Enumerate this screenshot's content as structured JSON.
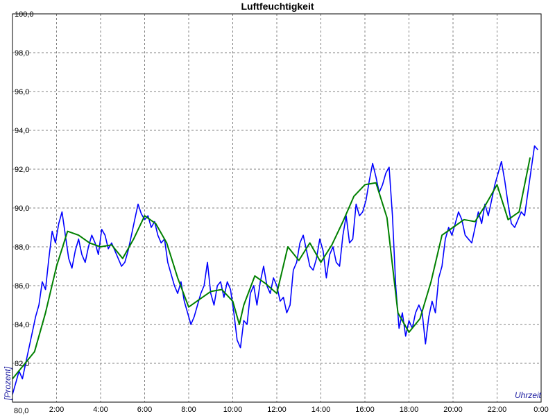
{
  "chart_data": {
    "type": "line",
    "title": "Luftfeuchtigkeit",
    "xlabel": "Uhrzeit",
    "ylabel": "[Prozent]",
    "xlim": [
      0,
      24
    ],
    "ylim": [
      80,
      100
    ],
    "grid": true,
    "x_tick_labels": [
      "2:00",
      "4:00",
      "6:00",
      "8:00",
      "10:00",
      "12:00",
      "14:00",
      "16:00",
      "18:00",
      "20:00",
      "22:00",
      "0:00"
    ],
    "y_tick_labels": [
      "82,0",
      "84,0",
      "86,0",
      "88,0",
      "90,0",
      "92,0",
      "94,0",
      "96,0",
      "98,0",
      "100,0"
    ],
    "corner_label": "80,0",
    "series": [
      {
        "color": "#0000ff",
        "x": [
          0.0,
          0.15,
          0.3,
          0.45,
          0.6,
          0.75,
          0.9,
          1.05,
          1.2,
          1.35,
          1.5,
          1.65,
          1.8,
          1.95,
          2.1,
          2.25,
          2.4,
          2.55,
          2.7,
          2.85,
          3.0,
          3.15,
          3.3,
          3.45,
          3.6,
          3.75,
          3.9,
          4.05,
          4.2,
          4.35,
          4.5,
          4.65,
          4.8,
          4.95,
          5.1,
          5.25,
          5.4,
          5.55,
          5.7,
          5.85,
          6.0,
          6.15,
          6.3,
          6.45,
          6.6,
          6.75,
          6.9,
          7.05,
          7.2,
          7.35,
          7.5,
          7.65,
          7.8,
          7.95,
          8.1,
          8.25,
          8.4,
          8.55,
          8.7,
          8.85,
          9.0,
          9.15,
          9.3,
          9.45,
          9.6,
          9.75,
          9.9,
          10.05,
          10.2,
          10.35,
          10.5,
          10.65,
          10.8,
          10.95,
          11.1,
          11.25,
          11.4,
          11.55,
          11.7,
          11.85,
          12.0,
          12.15,
          12.3,
          12.45,
          12.6,
          12.75,
          12.9,
          13.05,
          13.2,
          13.35,
          13.5,
          13.65,
          13.8,
          13.95,
          14.1,
          14.25,
          14.4,
          14.55,
          14.7,
          14.85,
          15.0,
          15.15,
          15.3,
          15.45,
          15.6,
          15.75,
          15.9,
          16.05,
          16.2,
          16.35,
          16.5,
          16.65,
          16.8,
          16.95,
          17.1,
          17.25,
          17.4,
          17.55,
          17.7,
          17.85,
          18.0,
          18.15,
          18.3,
          18.45,
          18.6,
          18.75,
          18.9,
          19.05,
          19.2,
          19.35,
          19.5,
          19.65,
          19.8,
          19.95,
          20.1,
          20.25,
          20.4,
          20.55,
          20.7,
          20.85,
          21.0,
          21.15,
          21.3,
          21.45,
          21.6,
          21.75,
          21.9,
          22.05,
          22.2,
          22.35,
          22.5,
          22.65,
          22.8,
          22.95,
          23.1,
          23.25,
          23.4,
          23.55,
          23.7,
          23.85
        ],
        "values": [
          80.4,
          81.0,
          81.6,
          81.2,
          82.0,
          82.8,
          83.6,
          84.4,
          85.0,
          86.2,
          85.8,
          87.4,
          88.8,
          88.2,
          89.2,
          89.8,
          88.6,
          87.4,
          86.9,
          87.8,
          88.4,
          87.6,
          87.2,
          88.0,
          88.6,
          88.2,
          87.6,
          88.9,
          88.6,
          87.9,
          88.2,
          87.8,
          87.4,
          87.0,
          87.2,
          87.8,
          88.6,
          89.4,
          90.2,
          89.7,
          89.4,
          89.6,
          89.0,
          89.3,
          88.6,
          88.2,
          88.4,
          87.2,
          86.6,
          86.0,
          85.6,
          86.2,
          85.2,
          84.6,
          84.0,
          84.4,
          85.0,
          85.6,
          86.0,
          87.2,
          85.6,
          85.0,
          86.0,
          86.2,
          85.4,
          86.2,
          85.8,
          84.6,
          83.2,
          82.8,
          84.2,
          84.0,
          85.6,
          86.0,
          85.0,
          86.2,
          87.0,
          86.0,
          85.6,
          86.4,
          86.0,
          85.2,
          85.4,
          84.6,
          85.0,
          86.8,
          87.2,
          88.2,
          88.6,
          87.8,
          87.0,
          86.8,
          87.4,
          88.4,
          87.8,
          86.4,
          87.6,
          88.0,
          87.2,
          87.0,
          88.6,
          89.6,
          88.2,
          88.4,
          90.2,
          89.6,
          89.8,
          90.4,
          91.4,
          92.3,
          91.6,
          90.8,
          91.2,
          91.8,
          92.1,
          89.6,
          86.0,
          83.8,
          84.6,
          83.4,
          84.2,
          83.8,
          84.6,
          85.0,
          84.6,
          83.0,
          84.4,
          85.2,
          84.6,
          86.4,
          87.0,
          88.4,
          89.0,
          88.6,
          89.2,
          89.8,
          89.4,
          88.6,
          88.4,
          88.2,
          89.0,
          89.8,
          89.2,
          90.2,
          89.6,
          90.4,
          91.2,
          91.8,
          92.4,
          91.4,
          90.2,
          89.2,
          89.0,
          89.4,
          89.8,
          89.6,
          90.8,
          92.0,
          93.2,
          93.0
        ]
      },
      {
        "color": "#008000",
        "x": [
          0.0,
          0.5,
          1.0,
          1.5,
          2.0,
          2.5,
          3.0,
          3.5,
          4.0,
          4.5,
          5.0,
          5.5,
          6.0,
          6.5,
          7.0,
          7.5,
          8.0,
          8.5,
          9.0,
          9.5,
          10.0,
          10.3,
          10.5,
          11.0,
          11.5,
          12.0,
          12.5,
          13.0,
          13.5,
          14.0,
          14.5,
          15.0,
          15.5,
          16.0,
          16.5,
          17.0,
          17.5,
          18.0,
          18.5,
          19.0,
          19.5,
          20.0,
          20.5,
          21.0,
          21.5,
          22.0,
          22.5,
          23.0,
          23.5
        ],
        "values": [
          81.2,
          81.9,
          82.6,
          84.6,
          87.0,
          88.8,
          88.6,
          88.2,
          88.0,
          88.1,
          87.4,
          88.4,
          89.6,
          89.2,
          88.2,
          86.4,
          84.9,
          85.3,
          85.7,
          85.8,
          85.2,
          84.0,
          85.0,
          86.5,
          86.1,
          85.6,
          88.0,
          87.3,
          88.2,
          87.2,
          88.1,
          89.3,
          90.6,
          91.2,
          91.3,
          89.5,
          84.6,
          83.6,
          84.3,
          86.2,
          88.6,
          89.0,
          89.4,
          89.3,
          90.2,
          91.2,
          89.4,
          89.8,
          92.6
        ]
      }
    ]
  }
}
